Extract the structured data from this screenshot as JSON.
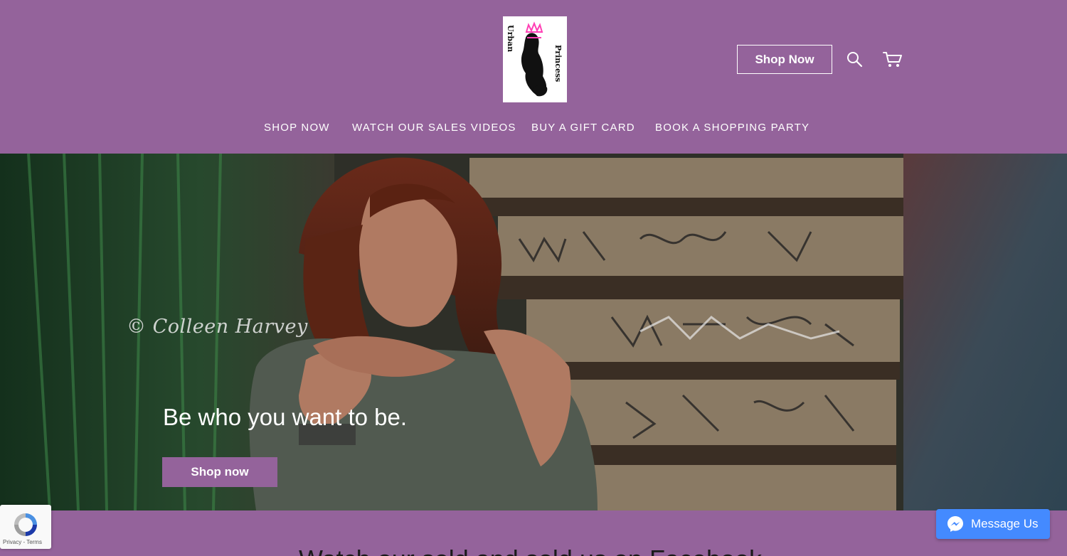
{
  "header": {
    "logo": {
      "line1": "Urban",
      "line2": "Princess"
    },
    "shop_now_label": "Shop Now",
    "icons": {
      "search": "search-icon",
      "cart": "cart-icon"
    }
  },
  "nav": {
    "items": [
      {
        "label": "SHOP NOW"
      },
      {
        "label": "WATCH OUR SALES VIDEOS"
      },
      {
        "label": "BUY A GIFT CARD"
      },
      {
        "label": "BOOK A SHOPPING PARTY"
      }
    ]
  },
  "hero": {
    "watermark": "© Colleen Harvey",
    "heading": "Be who you want to be.",
    "button_label": "Shop now"
  },
  "section": {
    "heading": "Watch our sold and sold us on Facebook"
  },
  "recaptcha": {
    "links": "Privacy - Terms"
  },
  "chat_widget": {
    "label": "Message Us"
  },
  "colors": {
    "brand": "#94639b",
    "chat": "#448aff",
    "white": "#ffffff"
  }
}
